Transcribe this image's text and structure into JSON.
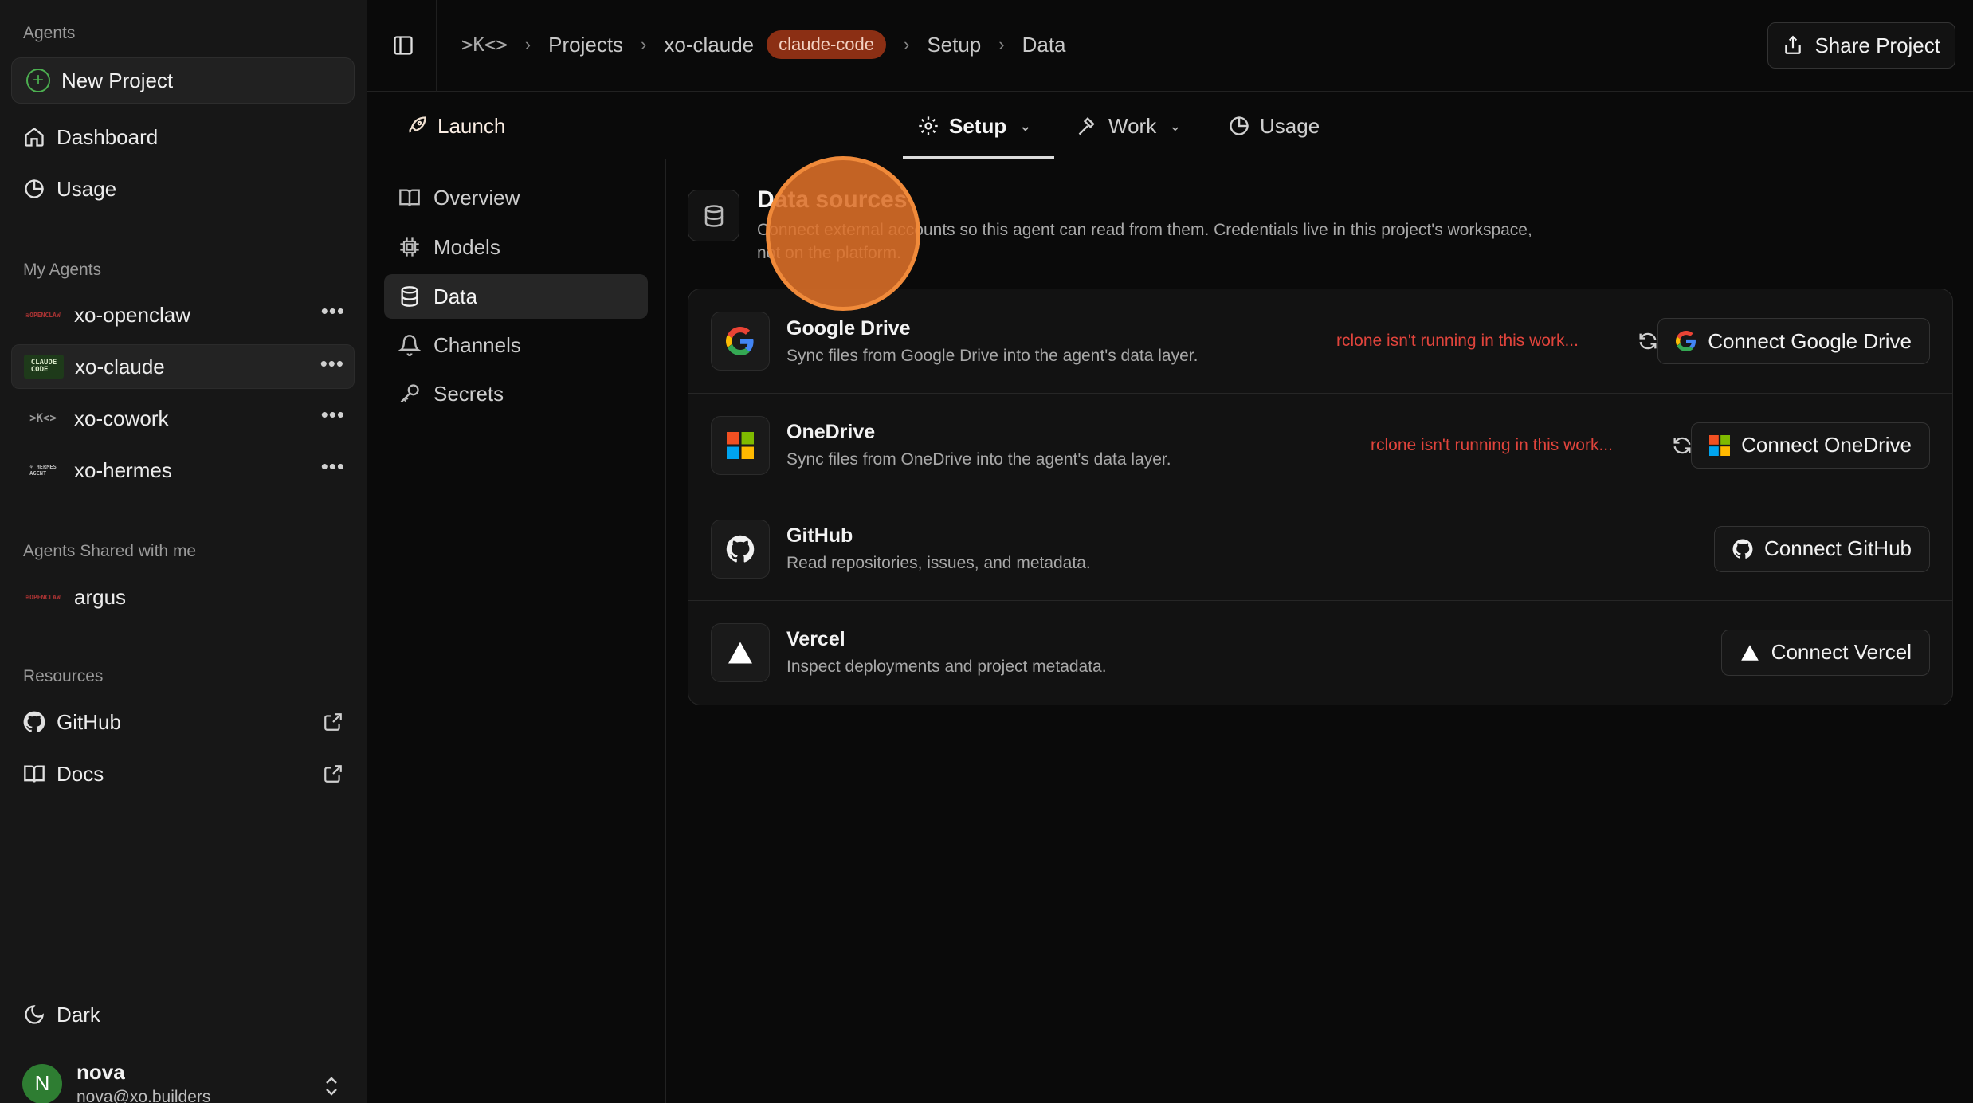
{
  "sidebar": {
    "agents_section": "Agents",
    "new_project": "New Project",
    "nav": [
      {
        "label": "Dashboard",
        "icon": "home-icon"
      },
      {
        "label": "Usage",
        "icon": "pie-chart-icon"
      }
    ],
    "my_agents_section": "My Agents",
    "my_agents": [
      {
        "name": "xo-openclaw",
        "logo": "OPENCLAW",
        "active": false
      },
      {
        "name": "xo-claude",
        "logo": "CLAUDE CODE",
        "active": true
      },
      {
        "name": "xo-cowork",
        "logo": ">K<>",
        "active": false
      },
      {
        "name": "xo-hermes",
        "logo": "HERMES AGENT",
        "active": false
      }
    ],
    "shared_section": "Agents Shared with me",
    "shared_agents": [
      {
        "name": "argus",
        "logo": "OPENCLAW"
      }
    ],
    "resources_section": "Resources",
    "resources": [
      {
        "label": "GitHub",
        "icon": "github-icon"
      },
      {
        "label": "Docs",
        "icon": "book-icon"
      }
    ],
    "theme_label": "Dark",
    "user": {
      "initial": "N",
      "name": "nova",
      "email": "nova@xo.builders"
    }
  },
  "topbar": {
    "breadcrumbs": [
      "Projects",
      "xo-claude",
      "Setup",
      "Data"
    ],
    "badge": "claude-code",
    "share_label": "Share Project"
  },
  "tabs": [
    {
      "label": "Launch",
      "icon": "rocket-icon"
    },
    {
      "label": "Setup",
      "icon": "gear-icon",
      "active": true
    },
    {
      "label": "Work",
      "icon": "hammer-icon"
    },
    {
      "label": "Usage",
      "icon": "pie-chart-icon"
    }
  ],
  "subnav": [
    {
      "label": "Overview",
      "icon": "book-icon"
    },
    {
      "label": "Models",
      "icon": "chip-icon"
    },
    {
      "label": "Data",
      "icon": "database-icon",
      "active": true
    },
    {
      "label": "Channels",
      "icon": "bell-icon"
    },
    {
      "label": "Secrets",
      "icon": "key-icon"
    }
  ],
  "data_sources": {
    "title": "Data sources",
    "description": "Connect external accounts so this agent can read from them. Credentials live in this project's workspace, not on the platform.",
    "items": [
      {
        "name": "Google Drive",
        "desc": "Sync files from Google Drive into the agent's data layer.",
        "error": "rclone isn't running in this work...",
        "button": "Connect Google Drive",
        "icon": "google-icon"
      },
      {
        "name": "OneDrive",
        "desc": "Sync files from OneDrive into the agent's data layer.",
        "error": "rclone isn't running in this work...",
        "button": "Connect OneDrive",
        "icon": "microsoft-icon"
      },
      {
        "name": "GitHub",
        "desc": "Read repositories, issues, and metadata.",
        "error": "",
        "button": "Connect GitHub",
        "icon": "github-icon"
      },
      {
        "name": "Vercel",
        "desc": "Inspect deployments and project metadata.",
        "error": "",
        "button": "Connect Vercel",
        "icon": "vercel-icon"
      }
    ]
  },
  "colors": {
    "accent_orange": "#f08a3a",
    "badge_bg": "#8b2f14",
    "error": "#e0443c",
    "active_green": "#4caf50"
  }
}
